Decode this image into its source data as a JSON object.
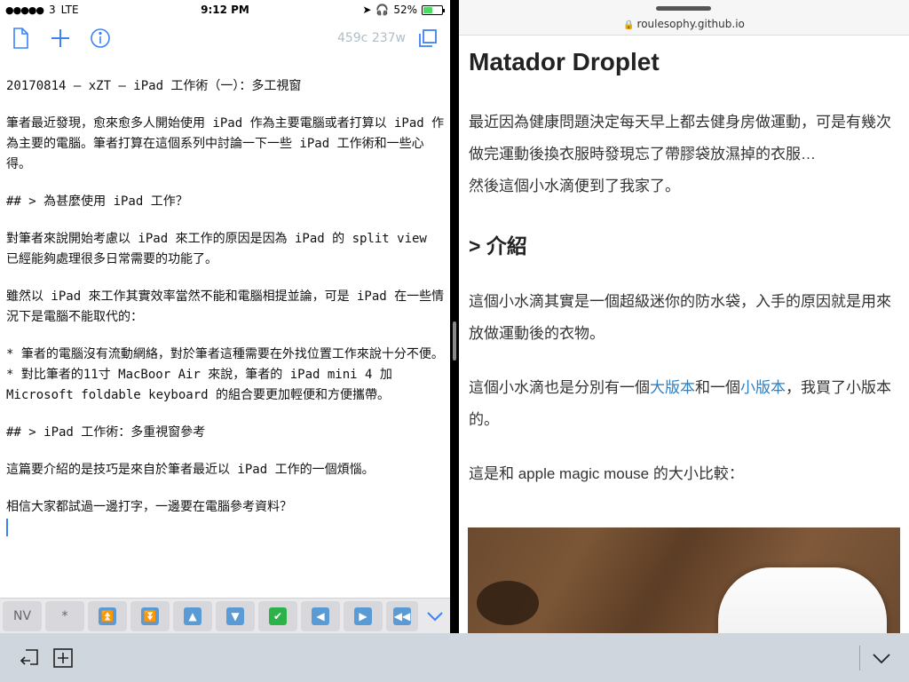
{
  "status": {
    "signal": "●●●●●",
    "carrier": "3",
    "network": "LTE",
    "time": "9:12 PM",
    "battery": "52%"
  },
  "editor": {
    "word_count": "459c 237w",
    "lines": [
      "20170814 – xZT – iPad 工作術（一）：多工視窗",
      "筆者最近發現，愈來愈多人開始使用 iPad 作為主要電腦或者打算以 iPad 作為主要的電腦。筆者打算在這個系列中討論一下一些 iPad 工作術和一些心得。",
      "## > 為甚麼使用 iPad 工作？",
      "對筆者來說開始考慮以 iPad 來工作的原因是因為 iPad 的 split view 已經能夠處理很多日常需要的功能了。",
      "雖然以 iPad 來工作其實效率當然不能和電腦相提並論，可是 iPad 在一些情況下是電腦不能取代的：",
      "* 筆者的電腦沒有流動網絡，對於筆者這種需要在外找位置工作來說十分不便。",
      "* 對比筆者的11寸 MacBoor Air 來說，筆者的 iPad mini 4 加 Microsoft foldable keyboard 的組合要更加輕便和方便攜帶。",
      "## > iPad 工作術：多重視窗參考",
      "這篇要介紹的是技巧是來自於筆者最近以 iPad 工作的一個煩惱。",
      "相信大家都試過一邊打字，一邊要在電腦參考資料？"
    ]
  },
  "keys": {
    "nv": "NV",
    "star": "*"
  },
  "browser": {
    "url": "roulesophy.github.io",
    "title": "Matador Droplet",
    "p1a": "最近因為健康問題決定每天早上都去健身房做運動，可是有幾次做完運動後換衣服時發現忘了帶膠袋放濕掉的衣服…",
    "p1b": "然後這個小水滴便到了我家了。",
    "h2": "> 介紹",
    "p2": "這個小水滴其實是一個超級迷你的防水袋，入手的原因就是用來放做運動後的衣物。",
    "p3_before": "這個小水滴也是分別有一個",
    "p3_link1": "大版本",
    "p3_mid": "和一個",
    "p3_link2": "小版本",
    "p3_after": "，我買了小版本的。",
    "p4": "這是和 apple magic mouse 的大小比較："
  }
}
